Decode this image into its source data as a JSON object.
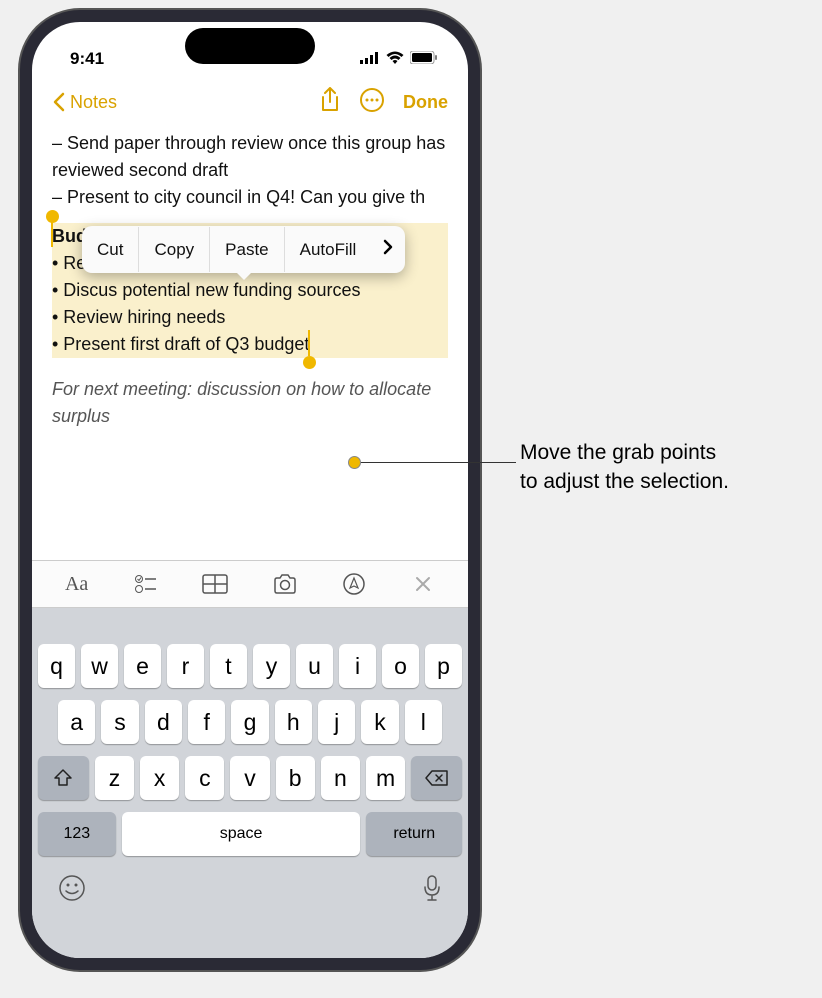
{
  "status": {
    "time": "9:41"
  },
  "nav": {
    "back": "Notes",
    "done": "Done"
  },
  "content": {
    "line1": "– Send paper through review once this group has reviewed second draft",
    "line2": "– Present to city council in Q4! Can you give th"
  },
  "callout": {
    "cut": "Cut",
    "copy": "Copy",
    "paste": "Paste",
    "autofill": "AutoFill"
  },
  "selection": {
    "title": "Budget check-in",
    "b1": "• Recap of Q2 finances from Jasmine",
    "b2": "• Discus potential new funding sources",
    "b3": "• Review hiring needs",
    "b4": "• Present first draft of Q3 budget"
  },
  "italic_note": "For next meeting: discussion on how to allocate surplus",
  "keyboard": {
    "row1": [
      "q",
      "w",
      "e",
      "r",
      "t",
      "y",
      "u",
      "i",
      "o",
      "p"
    ],
    "row2": [
      "a",
      "s",
      "d",
      "f",
      "g",
      "h",
      "j",
      "k",
      "l"
    ],
    "row3": [
      "z",
      "x",
      "c",
      "v",
      "b",
      "n",
      "m"
    ],
    "numbers": "123",
    "space": "space",
    "return": "return"
  },
  "annotation": {
    "line1": "Move the grab points",
    "line2": "to adjust the selection."
  }
}
